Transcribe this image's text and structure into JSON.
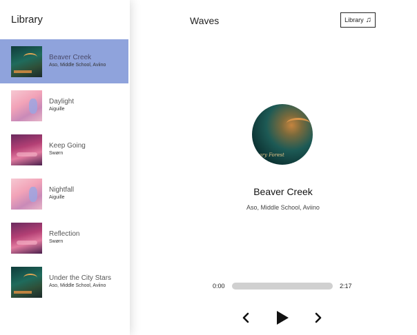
{
  "sidebar": {
    "title": "Library",
    "songs": [
      {
        "name": "Beaver Creek",
        "artist": "Aso, Middle School, Aviino",
        "cover": "forest",
        "selected": true
      },
      {
        "name": "Daylight",
        "artist": "Aiguille",
        "cover": "pink",
        "selected": false
      },
      {
        "name": "Keep Going",
        "artist": "Swørn",
        "cover": "purple",
        "selected": false
      },
      {
        "name": "Nightfall",
        "artist": "Aiguille",
        "cover": "pink",
        "selected": false
      },
      {
        "name": "Reflection",
        "artist": "Swørn",
        "cover": "purple",
        "selected": false
      },
      {
        "name": "Under the City Stars",
        "artist": "Aso, Middle School, Aviino",
        "cover": "forest",
        "selected": false
      }
    ]
  },
  "header": {
    "title": "Waves",
    "library_button": {
      "label": "Library",
      "icon": "music-note-icon"
    }
  },
  "player": {
    "disc_caption": "nary Forest",
    "track_title": "Beaver Creek",
    "track_artist": "Aso, Middle School, Aviino",
    "current_time": "0:00",
    "duration": "2:17",
    "progress": 0
  },
  "colors": {
    "selected_row": "#8fa3dc",
    "seek_track": "#d0d0d0"
  }
}
